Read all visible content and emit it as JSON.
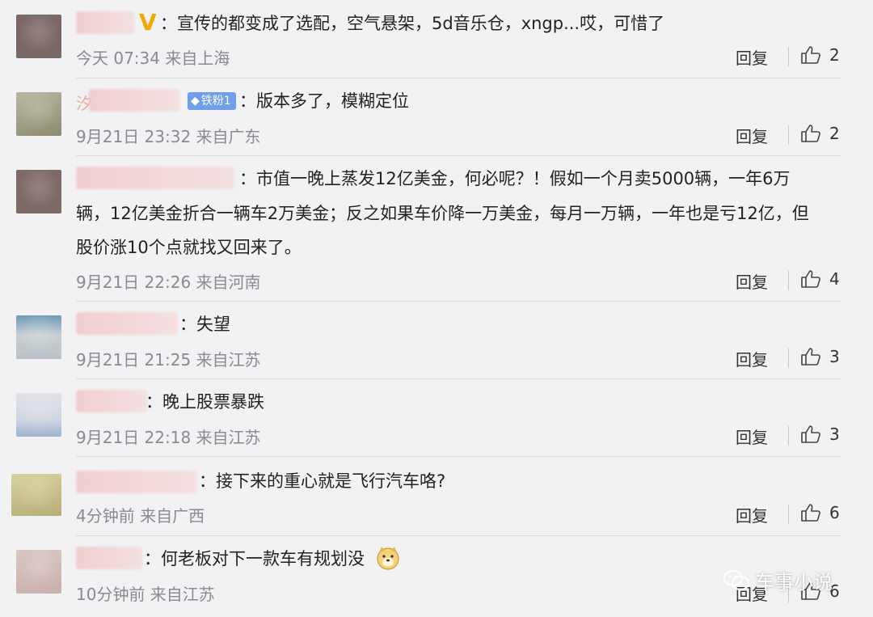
{
  "colors": {
    "background": "#f2f2f4",
    "vip": "#f2a900",
    "fan_badge": "#6f9fe8",
    "meta": "#8a8a8f"
  },
  "comments": [
    {
      "name_lead": "",
      "text_lines": [
        "：宣传的都变成了选配，空气悬架，5d音乐仓，xngp...哎，可惜了"
      ],
      "time": "今天 07:34 来自上海",
      "reply": "回复",
      "likes": "2",
      "badge": "V"
    },
    {
      "name_lead": "汐",
      "text_lines": [
        "：版本多了，模糊定位"
      ],
      "time": "9月21日 23:32 来自广东",
      "reply": "回复",
      "likes": "2",
      "fan_badge": "铁粉1"
    },
    {
      "name_lead": "",
      "text_lines": [
        "：市值一晚上蒸发12亿美金，何必呢？！假如一个月卖5000辆，一年6万",
        "辆，12亿美金折合一辆车2万美金；反之如果车价降一万美金，每月一万辆，一年也是亏12亿，但",
        "股价涨10个点就找又回来了。"
      ],
      "time": "9月21日 22:26 来自河南",
      "reply": "回复",
      "likes": "4"
    },
    {
      "name_lead": "",
      "text_lines": [
        "：失望"
      ],
      "time": "9月21日 21:25 来自江苏",
      "reply": "回复",
      "likes": "3"
    },
    {
      "name_lead": "",
      "text_lines": [
        "：晚上股票暴跌"
      ],
      "time": "9月21日 22:18 来自江苏",
      "reply": "回复",
      "likes": "3"
    },
    {
      "name_lead": "",
      "text_lines": [
        "：接下来的重心就是飞行汽车咯?"
      ],
      "time": "4分钟前 来自广西",
      "reply": "回复",
      "likes": "6"
    },
    {
      "name_lead": "",
      "text_lines": [
        "：何老板对下一款车有规划没"
      ],
      "time": "10分钟前 来自江苏",
      "reply": "回复",
      "likes": "6",
      "emoji": "dog-emoji"
    }
  ],
  "watermark": {
    "text": "车事小说",
    "icon": "wechat-icon"
  }
}
